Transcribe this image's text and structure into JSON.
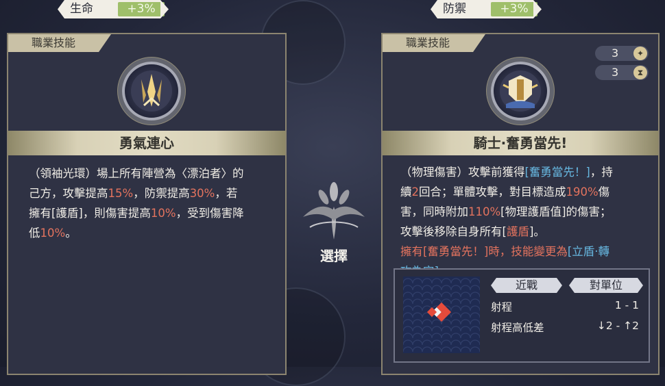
{
  "left_stat": {
    "label": "生命",
    "value": "+3%"
  },
  "right_stat": {
    "label": "防禦",
    "value": "+3%"
  },
  "left_card": {
    "tab": "職業技能",
    "emblem_icon": "sword-crest-icon",
    "name": "勇氣連心",
    "desc": [
      [
        {
          "t": "（領袖光環）場上所有陣營為〈漂泊者〉的",
          "c": ""
        }
      ],
      [
        {
          "t": "己方，攻擊提高",
          "c": ""
        },
        {
          "t": "15%",
          "c": "red"
        },
        {
          "t": "，防禦提高",
          "c": ""
        },
        {
          "t": "30%",
          "c": "red"
        },
        {
          "t": "，若",
          "c": ""
        }
      ],
      [
        {
          "t": "擁有[護盾]，則傷害提高",
          "c": ""
        },
        {
          "t": "10%",
          "c": "red"
        },
        {
          "t": "，受到傷害降",
          "c": ""
        }
      ],
      [
        {
          "t": "低",
          "c": ""
        },
        {
          "t": "10%",
          "c": "red"
        },
        {
          "t": "。",
          "c": ""
        }
      ]
    ]
  },
  "right_card": {
    "tab": "職業技能",
    "emblem_icon": "knight-crest-icon",
    "name": "騎士·奮勇當先!",
    "cost": {
      "value": "3",
      "icon": "star-icon"
    },
    "cooldown": {
      "value": "3",
      "icon": "hourglass-icon"
    },
    "desc": [
      [
        {
          "t": "（物理傷害）攻擊前獲得",
          "c": ""
        },
        {
          "t": "[奮勇當先！]",
          "c": "blue"
        },
        {
          "t": "，持",
          "c": ""
        }
      ],
      [
        {
          "t": "續",
          "c": ""
        },
        {
          "t": "2",
          "c": "red"
        },
        {
          "t": "回合；單體攻擊，對目標造成",
          "c": ""
        },
        {
          "t": "190%",
          "c": "red"
        },
        {
          "t": "傷",
          "c": ""
        }
      ],
      [
        {
          "t": "害，同時附加",
          "c": ""
        },
        {
          "t": "110%",
          "c": "red"
        },
        {
          "t": "[物理護盾值]的傷害；",
          "c": ""
        }
      ],
      [
        {
          "t": "攻擊後移除自身所有[",
          "c": ""
        },
        {
          "t": "護盾",
          "c": "red"
        },
        {
          "t": "]。",
          "c": ""
        }
      ],
      [
        {
          "t": "擁有[奮勇當先！]時，技能變更為",
          "c": "orange"
        },
        {
          "t": "[立盾·轉",
          "c": "blue"
        }
      ],
      [
        {
          "t": "攻為守]",
          "c": "blue"
        },
        {
          "t": "。",
          "c": "orange"
        }
      ]
    ],
    "range": {
      "tags": [
        "近戰",
        "對單位"
      ],
      "rows": [
        {
          "key": "射程",
          "value": "1 - 1"
        },
        {
          "key": "射程高低差",
          "value": "↓2 - ↑2"
        }
      ]
    }
  },
  "select": {
    "label": "選擇",
    "icon": "tree-emblem-icon"
  }
}
